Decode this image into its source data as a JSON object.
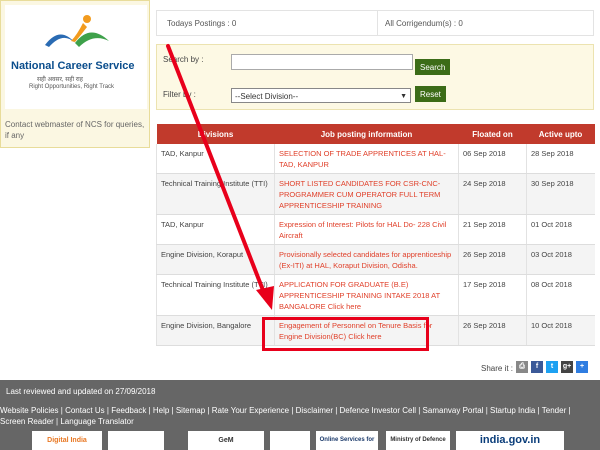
{
  "brand": {
    "name": "National Career Service",
    "hindi": "सही अवसर, सही राह",
    "tagline": "Right Opportunities, Right Track",
    "contact_note": "Contact webmaster of NCS for queries, if any"
  },
  "stats": {
    "todays_postings": "Todays Postings : 0",
    "all_corrigendum": "All Corrigendum(s) : 0"
  },
  "filters": {
    "search_label": "Search by :",
    "search_value": "",
    "search_button": "Search",
    "filter_label": "Filter by :",
    "division_selected": "--Select Division--",
    "reset_button": "Reset"
  },
  "table": {
    "headers": [
      "Divisions",
      "Job posting information",
      "Floated on",
      "Active upto"
    ],
    "rows": [
      {
        "division": "TAD, Kanpur",
        "job": "SELECTION OF TRADE APPRENTICES AT HAL-TAD, KANPUR",
        "floated": "06 Sep 2018",
        "active": "28 Sep 2018"
      },
      {
        "division": "Technical Training Institute (TTI)",
        "job": "SHORT LISTED CANDIDATES FOR CSR-CNC-PROGRAMMER CUM OPERATOR FULL TERM APPRENTICESHIP TRAINING",
        "floated": "24 Sep 2018",
        "active": "30 Sep 2018"
      },
      {
        "division": "TAD, Kanpur",
        "job": "Expression of Interest: Pilots for HAL Do- 228 Civil Aircraft",
        "floated": "21 Sep 2018",
        "active": "01 Oct 2018"
      },
      {
        "division": "Engine Division, Koraput",
        "job": "Provisionally selected candidates for apprenticeship (Ex-ITI) at HAL, Koraput Division, Odisha.",
        "floated": "26 Sep 2018",
        "active": "03 Oct 2018"
      },
      {
        "division": "Technical Training Institute (TTI)",
        "job": "APPLICATION FOR GRADUATE (B.E) APPRENTICESHIP TRAINING INTAKE 2018 AT BANGALORE Click here",
        "floated": "17 Sep 2018",
        "active": "08 Oct 2018"
      },
      {
        "division": "Engine Division, Bangalore",
        "job": "Engagement of Personnel on Tenure Basis for Engine Division(BC) Click here",
        "floated": "26 Sep 2018",
        "active": "10 Oct 2018"
      }
    ]
  },
  "share": {
    "label": "Share it :",
    "icons": [
      "print-icon",
      "facebook-icon",
      "twitter-icon",
      "google-plus-icon",
      "more-share-icon"
    ]
  },
  "footer": {
    "updated": "Last reviewed and updated on 27/09/2018",
    "links": [
      "Website Policies",
      "Contact Us",
      "Feedback",
      "Help",
      "Sitemap",
      "Rate Your Experience",
      "Disclaimer",
      "Defence Investor Cell",
      "Samanvay Portal",
      "Startup India",
      "Tender",
      "Screen Reader",
      "Language Translator"
    ],
    "link_separator": " | ",
    "logos": [
      "Digital India",
      "",
      "GeM",
      "",
      "Online Services for VOTERS",
      "Ministry of Defence",
      "india.gov.in"
    ]
  },
  "colors": {
    "header_red": "#c13a2c",
    "button_green": "#3c6c17",
    "link_red": "#e0402a",
    "annotation_red": "#e8001b",
    "footer_gray": "#666666"
  }
}
